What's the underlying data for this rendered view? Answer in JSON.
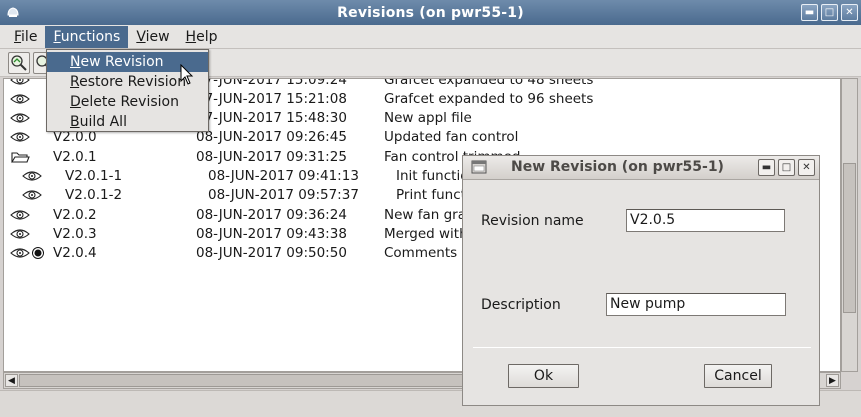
{
  "window": {
    "title": "Revisions (on pwr55-1)"
  },
  "menubar": [
    {
      "label": "File",
      "u": "F",
      "rest": "ile"
    },
    {
      "label": "Functions",
      "u": "F",
      "rest": "unctions"
    },
    {
      "label": "View",
      "u": "V",
      "rest": "iew"
    },
    {
      "label": "Help",
      "u": "H",
      "rest": "elp"
    }
  ],
  "functions_menu": [
    {
      "u": "N",
      "rest": "ew Revision"
    },
    {
      "u": "R",
      "rest": "estore Revision"
    },
    {
      "u": "D",
      "rest": "elete Revision"
    },
    {
      "u": "B",
      "rest": "uild All"
    }
  ],
  "revisions": [
    {
      "name": "",
      "date": "07-JUN-2017 15:09:24",
      "desc": "Grafcet expanded to 48 sheets"
    },
    {
      "name": "",
      "date": "07-JUN-2017 15:21:08",
      "desc": "Grafcet expanded to 96 sheets"
    },
    {
      "name": "",
      "date": "07-JUN-2017 15:48:30",
      "desc": "New appl file"
    },
    {
      "name": "V2.0.0",
      "date": "08-JUN-2017 09:26:45",
      "desc": "Updated fan control"
    },
    {
      "name": "V2.0.1",
      "date": "08-JUN-2017 09:31:25",
      "desc": "Fan control trimmed"
    },
    {
      "name": "V2.0.1-1",
      "date": "08-JUN-2017 09:41:13",
      "desc": "Init functio"
    },
    {
      "name": "V2.0.1-2",
      "date": "08-JUN-2017 09:57:37",
      "desc": "Print functi"
    },
    {
      "name": "V2.0.2",
      "date": "08-JUN-2017 09:36:24",
      "desc": "New fan gra"
    },
    {
      "name": "V2.0.3",
      "date": "08-JUN-2017 09:43:38",
      "desc": "Merged with"
    },
    {
      "name": "V2.0.4",
      "date": "08-JUN-2017 09:50:50",
      "desc": "Comments"
    }
  ],
  "dialog": {
    "title": "New Revision (on pwr55-1)",
    "name_label": "Revision name",
    "name_value": "V2.0.5",
    "desc_label": "Description",
    "desc_value": "New pump",
    "ok_label": "Ok",
    "cancel_label": "Cancel"
  }
}
